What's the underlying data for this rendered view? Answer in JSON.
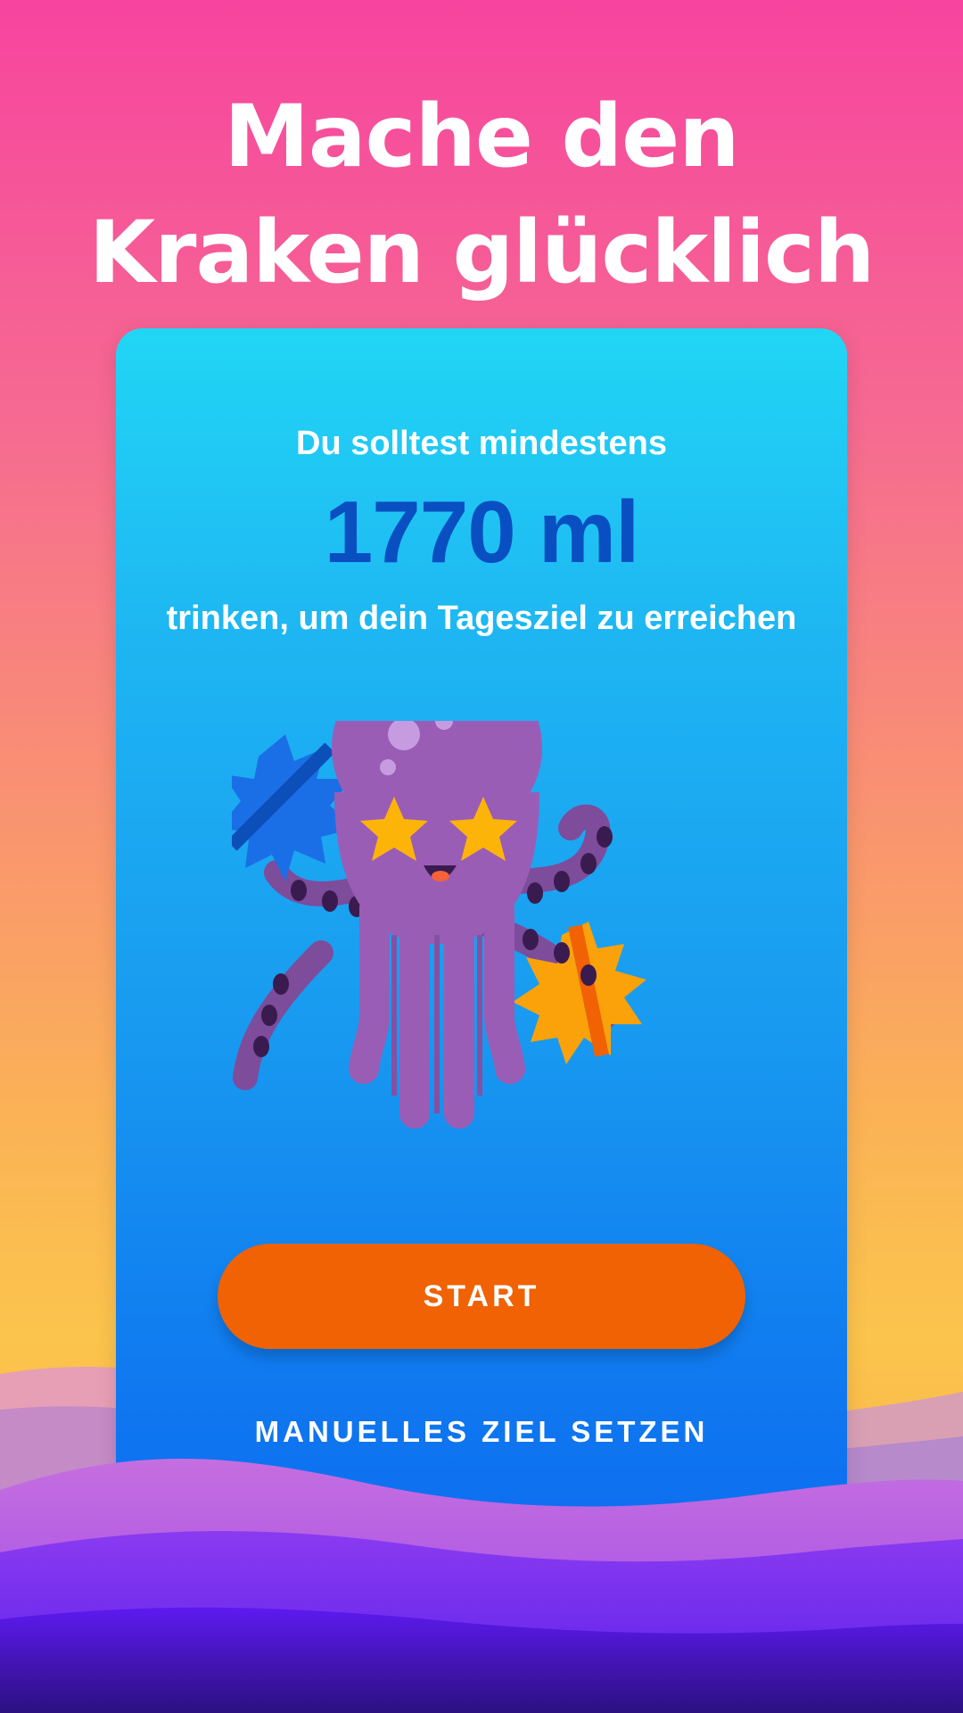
{
  "headline": {
    "line1": "Mache den",
    "line2": "Kraken glücklich"
  },
  "goal_card": {
    "intro": "Du solltest mindestens",
    "amount": "1770 ml",
    "outro": "trinken, um dein Tagesziel zu erreichen"
  },
  "actions": {
    "start_label": "START",
    "manual_goal_label": "MANUELLES ZIEL SETZEN"
  },
  "colors": {
    "amount": "#0a4fc2",
    "start_button": "#f06203",
    "octopus": "#9a5db5"
  },
  "illustration": {
    "name": "octopus-mascot-icon",
    "leaves": [
      "blue-leaf-icon",
      "orange-leaf-icon"
    ]
  }
}
